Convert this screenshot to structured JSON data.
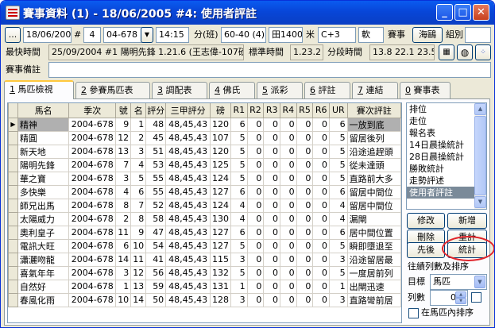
{
  "window": {
    "title": "賽事資料 (1) - 18/06/2005 #4: 使用者評註",
    "minimize": "_",
    "maximize": "□",
    "close": "✕"
  },
  "toolbar": {
    "more_button": "...",
    "date": "18/06/2005",
    "hash": "#",
    "race_no": "4",
    "race_code": "04-678",
    "time": "14:15",
    "class_label": "分(班)",
    "class_value": "60-40 (4)",
    "track": "田1400",
    "meter_label": "米",
    "course": "C+3",
    "going": "軟",
    "event_label": "賽事",
    "event_btn": "海鷗",
    "group_label": "組別"
  },
  "row2": {
    "fastest_label": "最快時間",
    "fastest_value": "25/09/2004 #1 陽明先鋒 1.21.6 (王志偉-107磅)",
    "standard_label": "標準時間",
    "standard_value": "1.23.2",
    "sectional_label": "分段時間",
    "sectional_value": "13.8  22.1  23.5"
  },
  "row3": {
    "remarks_label": "賽事備註",
    "remarks_value": ""
  },
  "tabs": [
    {
      "key": "1",
      "label": "馬匹檢視"
    },
    {
      "key": "2",
      "label": "參賽馬匹表"
    },
    {
      "key": "3",
      "label": "調配表"
    },
    {
      "key": "4",
      "label": "佛氏"
    },
    {
      "key": "5",
      "label": "派彩"
    },
    {
      "key": "6",
      "label": "評註"
    },
    {
      "key": "7",
      "label": "連結"
    },
    {
      "key": "0",
      "label": "賽事表"
    }
  ],
  "table": {
    "columns": [
      "馬名",
      "季次",
      "號",
      "名",
      "評分",
      "三甲評分",
      "磅",
      "R1",
      "R2",
      "R3",
      "R4",
      "R5",
      "R6",
      "UR",
      "賽次評註"
    ],
    "rows": [
      [
        "精神",
        "2004-678",
        "9",
        "1",
        "48",
        "48,45,43",
        "120",
        "6",
        "0",
        "0",
        "0",
        "0",
        "0",
        "6",
        "一放到底"
      ],
      [
        "精圓",
        "2004-678",
        "12",
        "2",
        "45",
        "48,45,43",
        "107",
        "5",
        "0",
        "0",
        "0",
        "0",
        "0",
        "5",
        "留居後列"
      ],
      [
        "新天地",
        "2004-678",
        "13",
        "3",
        "51",
        "48,45,43",
        "120",
        "5",
        "0",
        "0",
        "0",
        "0",
        "0",
        "5",
        "沿途追趕頭"
      ],
      [
        "陽明先鋒",
        "2004-678",
        "7",
        "4",
        "53",
        "48,45,43",
        "125",
        "5",
        "0",
        "0",
        "0",
        "0",
        "0",
        "5",
        "從未達頭"
      ],
      [
        "華之寶",
        "2004-678",
        "3",
        "5",
        "55",
        "48,45,43",
        "124",
        "5",
        "0",
        "0",
        "0",
        "0",
        "0",
        "5",
        "直路前大多"
      ],
      [
        "多快樂",
        "2004-678",
        "4",
        "6",
        "55",
        "48,45,43",
        "127",
        "6",
        "0",
        "0",
        "0",
        "0",
        "0",
        "6",
        "留居中間位"
      ],
      [
        "師兄出馬",
        "2004-678",
        "8",
        "7",
        "52",
        "48,45,43",
        "124",
        "4",
        "0",
        "0",
        "0",
        "0",
        "0",
        "4",
        "留居中間位"
      ],
      [
        "太陽威力",
        "2004-678",
        "2",
        "8",
        "58",
        "48,45,43",
        "130",
        "4",
        "0",
        "0",
        "0",
        "0",
        "0",
        "4",
        "漏閘"
      ],
      [
        "奧利皇子",
        "2004-678",
        "11",
        "9",
        "47",
        "48,45,43",
        "127",
        "6",
        "0",
        "0",
        "0",
        "0",
        "0",
        "6",
        "居中間位置"
      ],
      [
        "電訊大旺",
        "2004-678",
        "6",
        "10",
        "54",
        "48,45,43",
        "127",
        "5",
        "0",
        "0",
        "0",
        "0",
        "0",
        "5",
        "瞬即墮退至"
      ],
      [
        "瀟灑吻龍",
        "2004-678",
        "14",
        "11",
        "41",
        "48,45,43",
        "115",
        "3",
        "0",
        "0",
        "0",
        "0",
        "0",
        "3",
        "沿途留居最"
      ],
      [
        "喜氣年年",
        "2004-678",
        "3",
        "12",
        "56",
        "48,45,43",
        "132",
        "5",
        "0",
        "0",
        "0",
        "0",
        "0",
        "5",
        "一度居前列"
      ],
      [
        "自然好",
        "2004-678",
        "1",
        "13",
        "59",
        "48,45,43",
        "131",
        "1",
        "0",
        "0",
        "0",
        "0",
        "0",
        "1",
        "出閘迅速"
      ],
      [
        "春風化雨",
        "2004-678",
        "10",
        "14",
        "50",
        "48,45,43",
        "128",
        "3",
        "0",
        "0",
        "0",
        "0",
        "0",
        "3",
        "直路彎前居"
      ]
    ]
  },
  "listbox": {
    "items": [
      "排位",
      "走位",
      "報名表",
      "14日晨操統計",
      "28日晨操統計",
      "勝敗統計",
      "走勢評述",
      "使用者評註"
    ],
    "selected": "使用者評註"
  },
  "buttons": {
    "edit": "修改",
    "add": "新增",
    "delete": "刪除",
    "recalc": "重計",
    "order": "先後",
    "stats": "統計"
  },
  "sort_panel": {
    "title": "往績列數及排序",
    "target_label": "目標",
    "target_value": "馬匹",
    "count_label": "列數",
    "count_value": "0",
    "inside_label": "在馬匹內排序"
  },
  "colors": {
    "title_bar": "#0a5bf0",
    "highlight_ring": "#e0242b",
    "selected_item": "#7a8a99"
  }
}
